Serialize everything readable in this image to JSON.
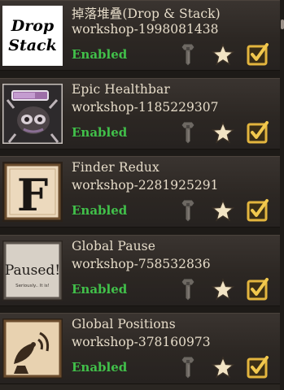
{
  "mods": [
    {
      "title": "掉落堆叠(Drop & Stack)",
      "id": "workshop-1998081438",
      "status": "Enabled",
      "logo_text": [
        "Drop",
        "Stack"
      ],
      "icon": "drop-stack-logo-icon"
    },
    {
      "title": "Epic Healthbar",
      "id": "workshop-1185229307",
      "status": "Enabled",
      "icon": "healthbar-creature-icon"
    },
    {
      "title": "Finder Redux",
      "id": "workshop-2281925291",
      "status": "Enabled",
      "logo_text": "F",
      "icon": "finder-letter-icon"
    },
    {
      "title": "Global Pause",
      "id": "workshop-758532836",
      "status": "Enabled",
      "logo_text": [
        "Paused!",
        "Seriously.. It is!"
      ],
      "icon": "paused-sign-icon"
    },
    {
      "title": "Global Positions",
      "id": "workshop-378160973",
      "status": "Enabled",
      "icon": "satellite-dish-icon"
    }
  ],
  "actions": {
    "configure_icon": "wrench-icon",
    "favorite_icon": "star-icon",
    "enabled_icon": "checkbox-checked-icon"
  },
  "colors": {
    "status_enabled": "#41c04a",
    "text": "#e6dcc9",
    "row_bg": "#2c2723",
    "star": "#f2e4c4",
    "checkbox": "#e3b53e"
  }
}
